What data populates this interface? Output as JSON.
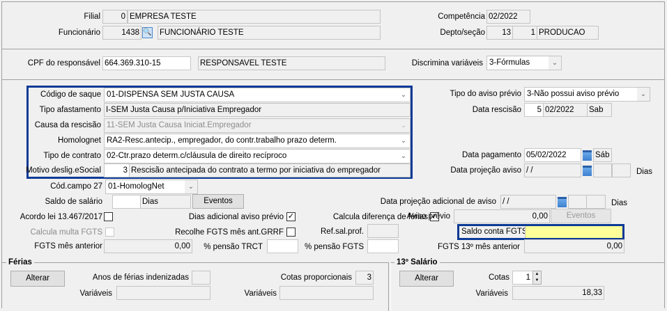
{
  "header": {
    "filial_label": "Filial",
    "filial_code": "0",
    "filial_name": "EMPRESA TESTE",
    "funcionario_label": "Funcionário",
    "funcionario_code": "1438",
    "funcionario_name": "FUNCIONÁRIO TESTE",
    "competencia_label": "Competência",
    "competencia": "02/2022",
    "depto_label": "Depto/seção",
    "depto": "13",
    "secao": "1",
    "secao_name": "PRODUCAO"
  },
  "responsavel": {
    "cpf_label": "CPF do responsável",
    "cpf": "664.369.310-15",
    "name": "RESPONSAVEL TESTE",
    "discrimina_label": "Discrimina variáveis",
    "discrimina": "3-Fórmulas"
  },
  "rescisao": {
    "codigo_saque_label": "Código de saque",
    "codigo_saque": "01-DISPENSA SEM JUSTA CAUSA",
    "tipo_afastamento_label": "Tipo afastamento",
    "tipo_afastamento": "I-SEM Justa Causa p/Iniciativa Empregador",
    "causa_label": "Causa da rescisão",
    "causa": "11-SEM Justa Causa Iniciat.Empregador",
    "homolognet_label": "Homolognet",
    "homolognet": "RA2-Resc.antecip., empregador, do contr.trabalho prazo determ.",
    "tipo_contrato_label": "Tipo de contrato",
    "tipo_contrato": "02-Ctr.prazo determ.c/cláusula de direito recíproco",
    "motivo_label": "Motivo deslig.eSocial",
    "motivo_code": "3",
    "motivo": "Rescisão antecipada do contrato a termo por iniciativa do empregador",
    "tipo_aviso_label": "Tipo do aviso prévio",
    "tipo_aviso": "3-Não possui aviso prévio",
    "data_rescisao_label": "Data rescisão",
    "data_rescisao_dia": "5",
    "data_rescisao_mes": "02/2022",
    "data_rescisao_semana": "Sab",
    "data_pagamento_label": "Data pagamento",
    "data_pagamento": "05/02/2022",
    "data_pagamento_semana": "Sáb",
    "data_projecao_label": "Data projeção aviso",
    "data_projecao": " / /",
    "dias_label": "Dias"
  },
  "outros": {
    "cod_campo27_label": "Cód.campo 27",
    "cod_campo27": "01-HomologNet",
    "saldo_salario_label": "Saldo de salário",
    "dias_label": "Dias",
    "eventos_label": "Eventos",
    "data_proj_adicional_label": "Data projeção adicional de aviso",
    "data_proj_adicional": " / /",
    "acordo_label": "Acordo lei 13.467/2017",
    "acordo_checked": false,
    "dias_adicional_label": "Dias adicional aviso prévio",
    "dias_adicional_checked": true,
    "calcula_dif_ferias_label": "Calcula diferença de férias",
    "calcula_dif_ferias_checked": true,
    "aviso_previo_label": "Aviso prévio",
    "aviso_previo": "0,00",
    "calcula_multa_label": "Calcula multa FGTS",
    "calcula_multa_checked": false,
    "recolhe_fgts_label": "Recolhe FGTS mês ant.GRRF",
    "recolhe_fgts_checked": false,
    "ref_sal_label": "Ref.sal.prof.",
    "saldo_fgts_label": "Saldo conta FGTS",
    "saldo_fgts": "",
    "fgts_mes_ant_label": "FGTS mês anterior",
    "fgts_mes_ant": "0,00",
    "pensao_trct_label": "% pensão TRCT",
    "pensao_fgts_label": "% pensão FGTS",
    "fgts_13_label": "FGTS 13º mês anterior",
    "fgts_13": "0,00"
  },
  "ferias": {
    "title": "Férias",
    "alterar_label": "Alterar",
    "anos_label": "Anos de férias indenizadas",
    "cotas_label": "Cotas proporcionais",
    "cotas": "3",
    "variaveis_label": "Variáveis"
  },
  "decimo": {
    "title": "13º Salário",
    "alterar_label": "Alterar",
    "cotas_label": "Cotas",
    "cotas": "1",
    "variaveis_label": "Variáveis",
    "variaveis": "18,33"
  },
  "colors": {
    "highlight_border": "#0b3a96",
    "saldo_fgts_bg": "#ffff99"
  }
}
